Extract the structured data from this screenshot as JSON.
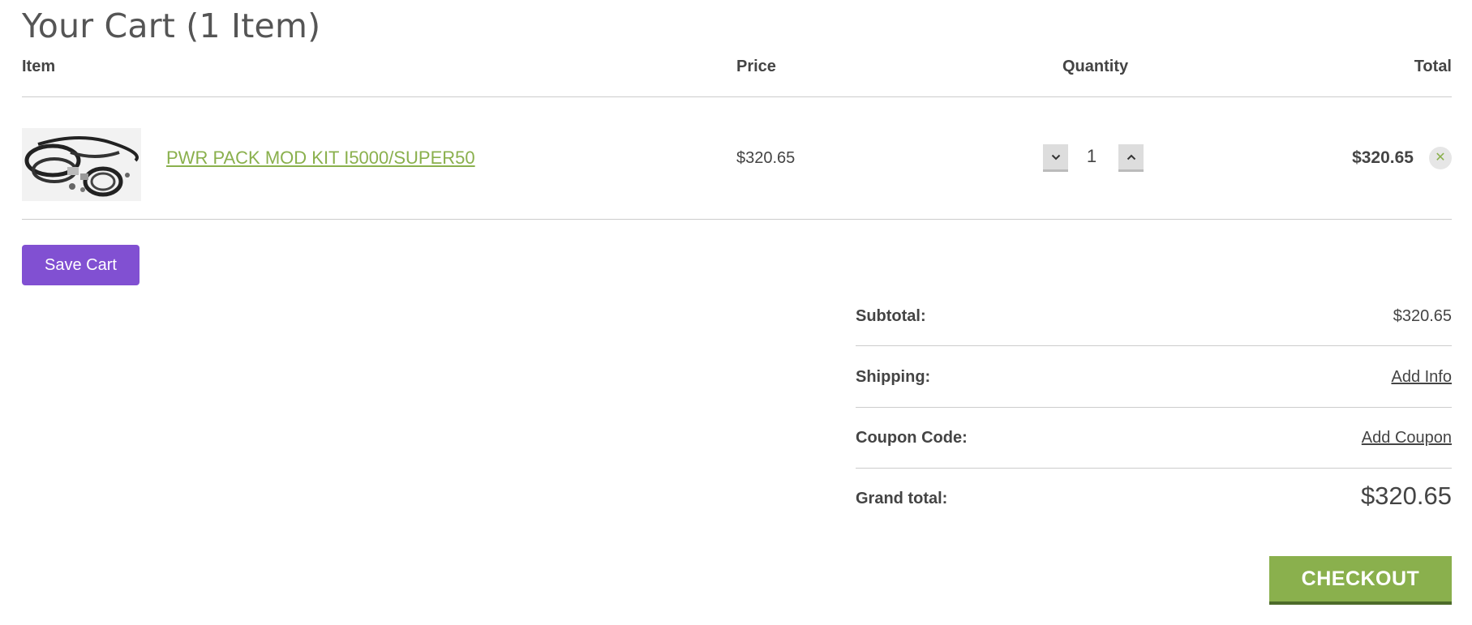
{
  "cart": {
    "title": "Your Cart (1 Item)",
    "headers": {
      "item": "Item",
      "price": "Price",
      "quantity": "Quantity",
      "total": "Total"
    },
    "items": [
      {
        "name": "PWR PACK MOD KIT I5000/SUPER50",
        "image": "hose-kit-product-photo",
        "price": "$320.65",
        "quantity": "1",
        "total": "$320.65"
      }
    ],
    "save_label": "Save Cart"
  },
  "summary": {
    "subtotal_label": "Subtotal:",
    "subtotal_value": "$320.65",
    "shipping_label": "Shipping:",
    "shipping_link": "Add Info",
    "coupon_label": "Coupon Code:",
    "coupon_link": "Add Coupon",
    "grand_label": "Grand total:",
    "grand_value": "$320.65"
  },
  "checkout_label": "CHECKOUT",
  "icons": {
    "decrement": "chevron-down-icon",
    "increment": "chevron-up-icon",
    "remove": "close-icon"
  },
  "colors": {
    "accent_green": "#8ab04d",
    "save_purple": "#8150d2",
    "checkout_border": "#4d6b2a"
  }
}
